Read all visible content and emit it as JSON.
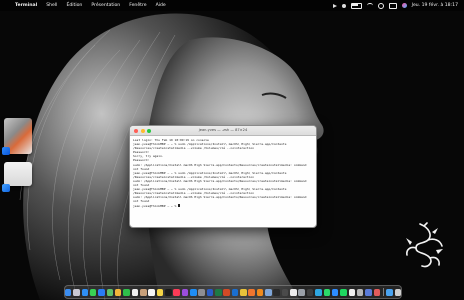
{
  "menubar": {
    "apple": "",
    "app_name": "Terminal",
    "menus": [
      "Shell",
      "Édition",
      "Présentation",
      "Fenêtre",
      "Aide"
    ],
    "clock": "Jeu. 19 févr. à 18:17"
  },
  "terminal": {
    "title": "jean-yves — -zsh — 87×24",
    "lines": [
      "Last login: Thu Feb 19 18:09:19 on console",
      "jean-yves@ThinkMBP — ~ % sudo /Applications/Install\\ macOS\\ High\\ Sierra.app/Contents",
      "/Resources/createinstallmedia --volume /Volumes/clé --nointeraction",
      "Password:",
      "Sorry, try again.",
      "Password:",
      "sudo: /Applications/Install macOS High Sierra.app/Contents/Resources/createinstallmedia: command",
      "not found",
      "jean-yves@ThinkMBP — ~ % sudo /Applications/Install\\ macOS\\ High\\ Sierra.app/Contents",
      "/Resources/createinstallmedia --volume /Volumes/clé --nointeraction",
      "sudo: /Applications/Install macOS High Sierra.app/Contents/Resources/createinstallmedia: command",
      "not found",
      "jean-yves@ThinkMBP — ~ % sudo /Applications/Install\\ macOS\\ High\\ Sierra.app/Contents",
      "/Resources/createinstallmedia --volume /Volumes/clé --nointeraction",
      "sudo: /Applications/Install macOS High Sierra.app/Contents/Resources/createinstallmedia: command",
      "not found",
      "jean-yves@ThinkMBP — ~ % "
    ]
  },
  "dock": {
    "apps": [
      {
        "name": "finder",
        "color": "#3b8df0"
      },
      {
        "name": "launchpad",
        "color": "#c9c9d4"
      },
      {
        "name": "safari",
        "color": "#2f8ff5"
      },
      {
        "name": "messages",
        "color": "#39d154"
      },
      {
        "name": "mail",
        "color": "#2a7cf7"
      },
      {
        "name": "maps",
        "color": "#5ec26a"
      },
      {
        "name": "photos",
        "color": "#f4b73a"
      },
      {
        "name": "facetime",
        "color": "#2fbf4a"
      },
      {
        "name": "calendar",
        "color": "#f2f2f2"
      },
      {
        "name": "contacts",
        "color": "#c8a07a"
      },
      {
        "name": "reminders",
        "color": "#f5f5f5"
      },
      {
        "name": "notes",
        "color": "#f5d547"
      },
      {
        "name": "tv",
        "color": "#1b1b1b"
      },
      {
        "name": "music",
        "color": "#fb3b57"
      },
      {
        "name": "podcasts",
        "color": "#9b4ddc"
      },
      {
        "name": "app-store",
        "color": "#1f8ef5"
      },
      {
        "name": "system-settings",
        "color": "#8e8e93"
      },
      {
        "name": "word",
        "color": "#2a5cc7"
      },
      {
        "name": "excel",
        "color": "#1d7a45"
      },
      {
        "name": "powerpoint",
        "color": "#d24a26"
      },
      {
        "name": "outlook",
        "color": "#1a6fd1"
      },
      {
        "name": "chrome",
        "color": "#e9c33a"
      },
      {
        "name": "firefox",
        "color": "#f0762f"
      },
      {
        "name": "vlc",
        "color": "#f08a1c"
      },
      {
        "name": "preview",
        "color": "#7fa6d8"
      },
      {
        "name": "terminal",
        "color": "#2a2a2a"
      },
      {
        "name": "activity-monitor",
        "color": "#4a4a4a"
      },
      {
        "name": "textedit",
        "color": "#ededed"
      },
      {
        "name": "disk-utility",
        "color": "#9aa0a8"
      },
      {
        "name": "calculator",
        "color": "#3c3c3c"
      },
      {
        "name": "telegram",
        "color": "#2ea6e0"
      },
      {
        "name": "whatsapp",
        "color": "#2bd96a"
      },
      {
        "name": "zoom",
        "color": "#2d8cff"
      },
      {
        "name": "spotify",
        "color": "#1ed760"
      },
      {
        "name": "notion",
        "color": "#f0f0f0"
      },
      {
        "name": "installer",
        "color": "#b6b6b6"
      },
      {
        "name": "app-icon",
        "color": "#5a7bd8"
      },
      {
        "name": "app-icon",
        "color": "#e25b5b"
      }
    ],
    "right": [
      {
        "name": "downloads-folder",
        "color": "#4aa3f0"
      },
      {
        "name": "trash",
        "color": "#cfcfcf"
      }
    ]
  }
}
